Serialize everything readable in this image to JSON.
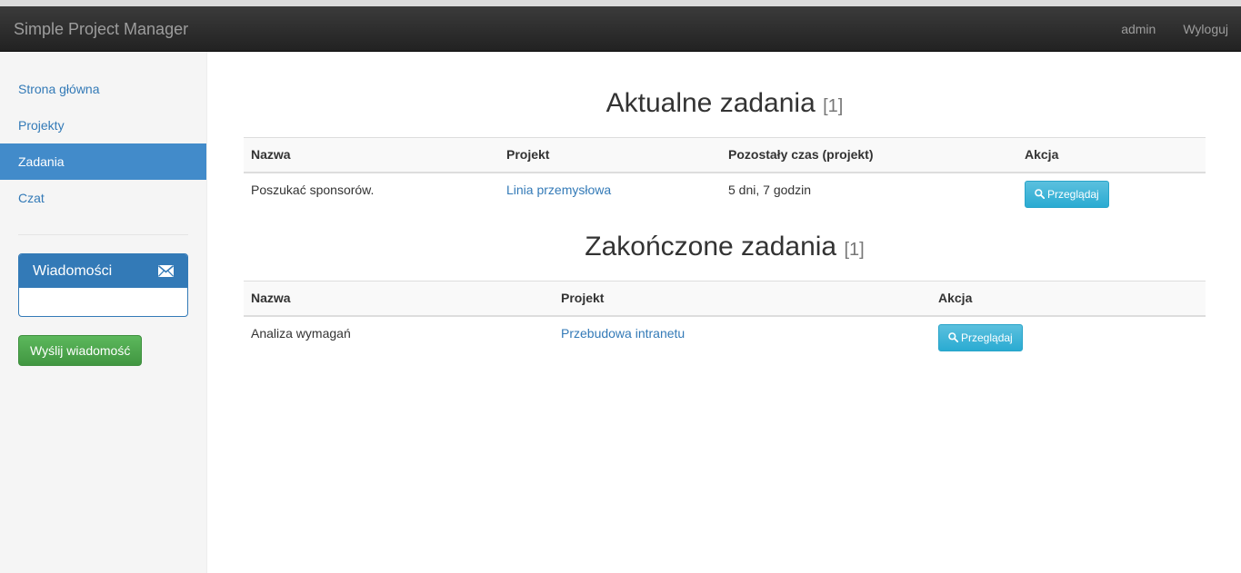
{
  "navbar": {
    "brand": "Simple Project Manager",
    "user": "admin",
    "logout": "Wyloguj"
  },
  "sidebar": {
    "items": [
      {
        "label": "Strona główna",
        "active": false
      },
      {
        "label": "Projekty",
        "active": false
      },
      {
        "label": "Zadania",
        "active": true
      },
      {
        "label": "Czat",
        "active": false
      }
    ],
    "messages_panel": {
      "title": "Wiadomości",
      "icon": "envelope-icon"
    },
    "send_button": "Wyślij wiadomość"
  },
  "current_tasks": {
    "title": "Aktualne zadania",
    "count": "[1]",
    "columns": [
      "Nazwa",
      "Projekt",
      "Pozostały czas (projekt)",
      "Akcja"
    ],
    "rows": [
      {
        "name": "Poszukać sponsorów.",
        "project": "Linia przemysłowa",
        "remaining": "5 dni, 7 godzin",
        "action": "Przeglądaj"
      }
    ]
  },
  "finished_tasks": {
    "title": "Zakończone zadania",
    "count": "[1]",
    "columns": [
      "Nazwa",
      "Projekt",
      "Akcja"
    ],
    "rows": [
      {
        "name": "Analiza wymagań",
        "project": "Przebudowa intranetu",
        "action": "Przeglądaj"
      }
    ]
  },
  "colors": {
    "navbar": "#222222",
    "link": "#337ab7",
    "active_nav": "#428bca",
    "info_button": "#5bc0de",
    "success_button": "#5cb85c"
  }
}
